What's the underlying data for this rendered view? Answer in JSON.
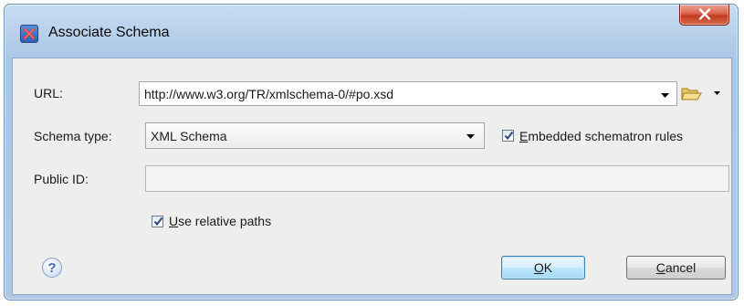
{
  "window": {
    "title": "Associate Schema"
  },
  "form": {
    "url_label": "URL:",
    "url_value": "http://www.w3.org/TR/xmlschema-0/#po.xsd",
    "schema_type_label": "Schema type:",
    "schema_type_value": "XML Schema",
    "embedded_rules_label_accel": "E",
    "embedded_rules_label_rest": "mbedded schematron rules",
    "embedded_rules_checked": true,
    "public_id_label": "Public ID:",
    "public_id_value": "",
    "relative_paths_label_accel": "U",
    "relative_paths_label_rest": "se relative paths",
    "relative_paths_checked": true
  },
  "buttons": {
    "ok_accel": "O",
    "ok_rest": "K",
    "cancel_accel": "C",
    "cancel_rest": "ancel",
    "help_glyph": "?"
  },
  "icons": {
    "app": "oxygen-x-icon",
    "close": "close-icon",
    "folder": "folder-open-icon",
    "dropdown": "chevron-down-icon",
    "help": "help-icon"
  },
  "colors": {
    "title_gradient_top": "#c7dcf2",
    "close_red": "#c23a20",
    "default_button_border": "#3c7fb1",
    "client_background": "#eeeeee"
  }
}
